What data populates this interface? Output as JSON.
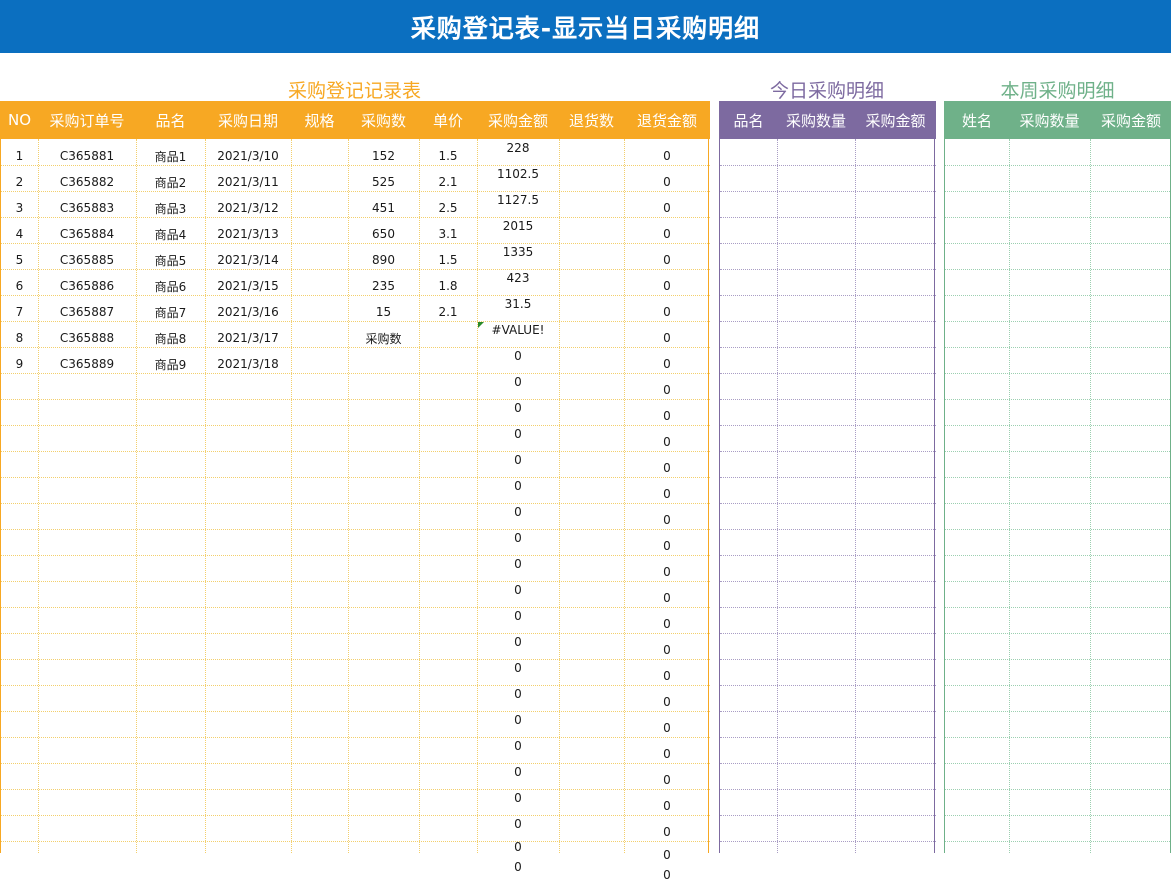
{
  "title": "采购登记表-显示当日采购明细",
  "main": {
    "section_title": "采购登记记录表",
    "header_color": "#f7a823",
    "grid_color": "#f3cf6c",
    "headers": [
      "NO",
      "采购订单号",
      "品名",
      "采购日期",
      "规格",
      "采购数",
      "单价",
      "采购金额",
      "退货数",
      "退货金额"
    ],
    "rows": [
      [
        "1",
        "C365881",
        "商品1",
        "2021/3/10",
        "",
        "152",
        "1.5",
        "228",
        "",
        "0"
      ],
      [
        "2",
        "C365882",
        "商品2",
        "2021/3/11",
        "",
        "525",
        "2.1",
        "1102.5",
        "",
        "0"
      ],
      [
        "3",
        "C365883",
        "商品3",
        "2021/3/12",
        "",
        "451",
        "2.5",
        "1127.5",
        "",
        "0"
      ],
      [
        "4",
        "C365884",
        "商品4",
        "2021/3/13",
        "",
        "650",
        "3.1",
        "2015",
        "",
        "0"
      ],
      [
        "5",
        "C365885",
        "商品5",
        "2021/3/14",
        "",
        "890",
        "1.5",
        "1335",
        "",
        "0"
      ],
      [
        "6",
        "C365886",
        "商品6",
        "2021/3/15",
        "",
        "235",
        "1.8",
        "423",
        "",
        "0"
      ],
      [
        "7",
        "C365887",
        "商品7",
        "2021/3/16",
        "",
        "15",
        "2.1",
        "31.5",
        "",
        "0"
      ],
      [
        "8",
        "C365888",
        "商品8",
        "2021/3/17",
        "",
        "采购数",
        "",
        "#VALUE!",
        "",
        "0"
      ],
      [
        "9",
        "C365889",
        "商品9",
        "2021/3/18",
        "",
        "",
        "",
        "0",
        "",
        "0"
      ],
      [
        "",
        "",
        "",
        "",
        "",
        "",
        "",
        "0",
        "",
        "0"
      ],
      [
        "",
        "",
        "",
        "",
        "",
        "",
        "",
        "0",
        "",
        "0"
      ],
      [
        "",
        "",
        "",
        "",
        "",
        "",
        "",
        "0",
        "",
        "0"
      ],
      [
        "",
        "",
        "",
        "",
        "",
        "",
        "",
        "0",
        "",
        "0"
      ],
      [
        "",
        "",
        "",
        "",
        "",
        "",
        "",
        "0",
        "",
        "0"
      ],
      [
        "",
        "",
        "",
        "",
        "",
        "",
        "",
        "0",
        "",
        "0"
      ],
      [
        "",
        "",
        "",
        "",
        "",
        "",
        "",
        "0",
        "",
        "0"
      ],
      [
        "",
        "",
        "",
        "",
        "",
        "",
        "",
        "0",
        "",
        "0"
      ],
      [
        "",
        "",
        "",
        "",
        "",
        "",
        "",
        "0",
        "",
        "0"
      ],
      [
        "",
        "",
        "",
        "",
        "",
        "",
        "",
        "0",
        "",
        "0"
      ],
      [
        "",
        "",
        "",
        "",
        "",
        "",
        "",
        "0",
        "",
        "0"
      ],
      [
        "",
        "",
        "",
        "",
        "",
        "",
        "",
        "0",
        "",
        "0"
      ],
      [
        "",
        "",
        "",
        "",
        "",
        "",
        "",
        "0",
        "",
        "0"
      ],
      [
        "",
        "",
        "",
        "",
        "",
        "",
        "",
        "0",
        "",
        "0"
      ],
      [
        "",
        "",
        "",
        "",
        "",
        "",
        "",
        "0",
        "",
        "0"
      ],
      [
        "",
        "",
        "",
        "",
        "",
        "",
        "",
        "0",
        "",
        "0"
      ],
      [
        "",
        "",
        "",
        "",
        "",
        "",
        "",
        "0",
        "",
        "0"
      ],
      [
        "",
        "",
        "",
        "",
        "",
        "",
        "",
        "0",
        "",
        "0"
      ],
      [
        "",
        "",
        "",
        "",
        "",
        "",
        "",
        "0",
        "",
        "0"
      ],
      [
        "",
        "",
        "",
        "",
        "",
        "",
        "",
        "0",
        "",
        "0"
      ]
    ]
  },
  "today": {
    "section_title": "今日采购明细",
    "header_color": "#7d6aa0",
    "grid_color": "#a99dc4",
    "headers": [
      "品名",
      "采购数量",
      "采购金额"
    ]
  },
  "week": {
    "section_title": "本周采购明细",
    "header_color": "#6fb189",
    "grid_color": "#9ccfb0",
    "headers": [
      "姓名",
      "采购数量",
      "采购金额"
    ]
  }
}
